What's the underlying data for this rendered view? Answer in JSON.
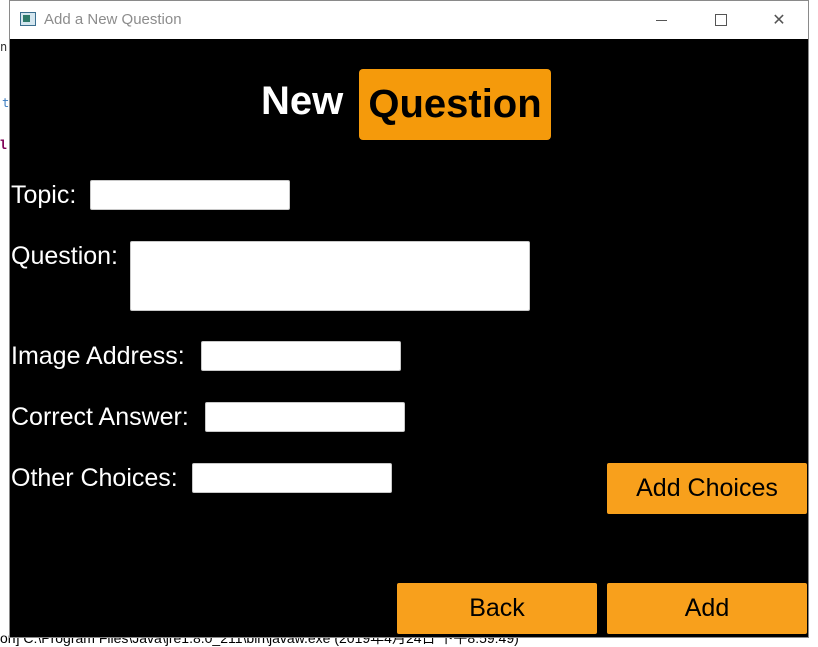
{
  "window": {
    "title": "Add a New Question"
  },
  "heading": {
    "word1": "New",
    "word2": "Question"
  },
  "form": {
    "topic_label": "Topic:",
    "topic_value": "",
    "question_label": "Question:",
    "question_value": "",
    "image_label": "Image Address:",
    "image_value": "",
    "correct_label": "Correct Answer:",
    "correct_value": "",
    "other_label": "Other Choices:",
    "other_value": ""
  },
  "buttons": {
    "add_choices": "Add Choices",
    "back": "Back",
    "add": "Add"
  },
  "background": {
    "status_text": "on] C:\\Program Files\\Java\\jre1.8.0_211\\bin\\javaw.exe (2019年4月24日 下午8:59:49)"
  },
  "colors": {
    "accent": "#f59a0b",
    "button": "#f8a01c",
    "content_bg": "#000000"
  }
}
